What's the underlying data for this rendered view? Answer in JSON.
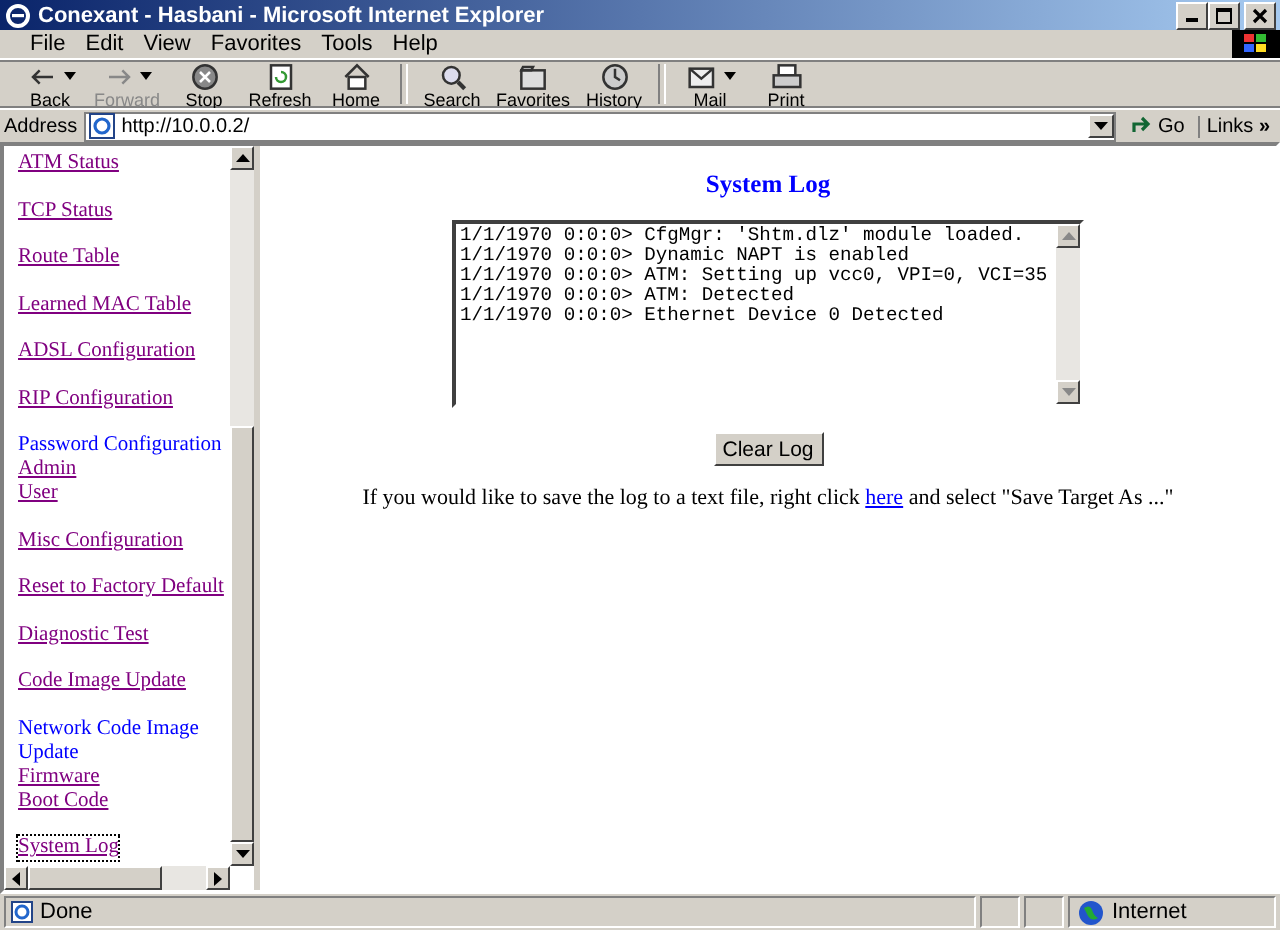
{
  "window": {
    "title": "Conexant - Hasbani - Microsoft Internet Explorer"
  },
  "menu": [
    "File",
    "Edit",
    "View",
    "Favorites",
    "Tools",
    "Help"
  ],
  "toolbar": [
    {
      "kind": "back",
      "label": "Back",
      "dropdown": true,
      "disabled": false
    },
    {
      "kind": "forward",
      "label": "Forward",
      "dropdown": true,
      "disabled": true
    },
    {
      "kind": "stop",
      "label": "Stop",
      "dropdown": false,
      "disabled": false
    },
    {
      "kind": "refresh",
      "label": "Refresh",
      "dropdown": false,
      "disabled": false
    },
    {
      "kind": "home",
      "label": "Home",
      "dropdown": false,
      "disabled": false
    },
    {
      "kind": "separator"
    },
    {
      "kind": "search",
      "label": "Search",
      "dropdown": false,
      "disabled": false
    },
    {
      "kind": "favorites",
      "label": "Favorites",
      "dropdown": false,
      "disabled": false
    },
    {
      "kind": "history",
      "label": "History",
      "dropdown": false,
      "disabled": false
    },
    {
      "kind": "separator"
    },
    {
      "kind": "mail",
      "label": "Mail",
      "dropdown": true,
      "disabled": false
    },
    {
      "kind": "print",
      "label": "Print",
      "dropdown": false,
      "disabled": false
    }
  ],
  "address": {
    "label": "Address",
    "url": "http://10.0.0.2/",
    "go": "Go",
    "links": "Links",
    "chevron": "»"
  },
  "sidebar": {
    "groups": [
      {
        "items": [
          {
            "kind": "link",
            "label": "ATM Status",
            "selected": false
          }
        ]
      },
      {
        "items": [
          {
            "kind": "link",
            "label": "TCP Status",
            "selected": false
          }
        ]
      },
      {
        "items": [
          {
            "kind": "link",
            "label": "Route Table",
            "selected": false
          }
        ]
      },
      {
        "items": [
          {
            "kind": "link",
            "label": "Learned MAC Table",
            "selected": false
          }
        ]
      },
      {
        "items": [
          {
            "kind": "link",
            "label": "ADSL Configuration",
            "selected": false
          }
        ]
      },
      {
        "items": [
          {
            "kind": "link",
            "label": "RIP Configuration",
            "selected": false
          }
        ]
      },
      {
        "items": [
          {
            "kind": "heading",
            "label": "Password Configuration",
            "selected": false
          },
          {
            "kind": "link",
            "label": "Admin",
            "selected": false
          },
          {
            "kind": "link",
            "label": "User",
            "selected": false
          }
        ]
      },
      {
        "items": [
          {
            "kind": "link",
            "label": "Misc Configuration",
            "selected": false
          }
        ]
      },
      {
        "items": [
          {
            "kind": "link",
            "label": "Reset to Factory Default",
            "selected": false
          }
        ]
      },
      {
        "items": [
          {
            "kind": "link",
            "label": "Diagnostic Test",
            "selected": false
          }
        ]
      },
      {
        "items": [
          {
            "kind": "link",
            "label": "Code Image Update",
            "selected": false
          }
        ]
      },
      {
        "items": [
          {
            "kind": "heading",
            "label": "Network Code Image Update",
            "selected": false
          },
          {
            "kind": "link",
            "label": "Firmware",
            "selected": false
          },
          {
            "kind": "link",
            "label": "Boot Code",
            "selected": false
          }
        ]
      },
      {
        "items": [
          {
            "kind": "link",
            "label": "System Log",
            "selected": true
          }
        ]
      }
    ]
  },
  "main": {
    "title": "System Log",
    "log_lines": [
      "1/1/1970 0:0:0> CfgMgr: 'Shtm.dlz' module loaded.",
      "1/1/1970 0:0:0> Dynamic NAPT is enabled",
      "1/1/1970 0:0:0> ATM: Setting up vcc0, VPI=0, VCI=35",
      "1/1/1970 0:0:0> ATM: Detected",
      "1/1/1970 0:0:0> Ethernet Device 0 Detected"
    ],
    "clear_button": "Clear Log",
    "note_before": "If you would like to save the log to a text file, right click",
    "note_link": "here",
    "note_after": "and select \"Save Target As ...\""
  },
  "status_bar": {
    "text": "Done",
    "zone": "Internet"
  }
}
